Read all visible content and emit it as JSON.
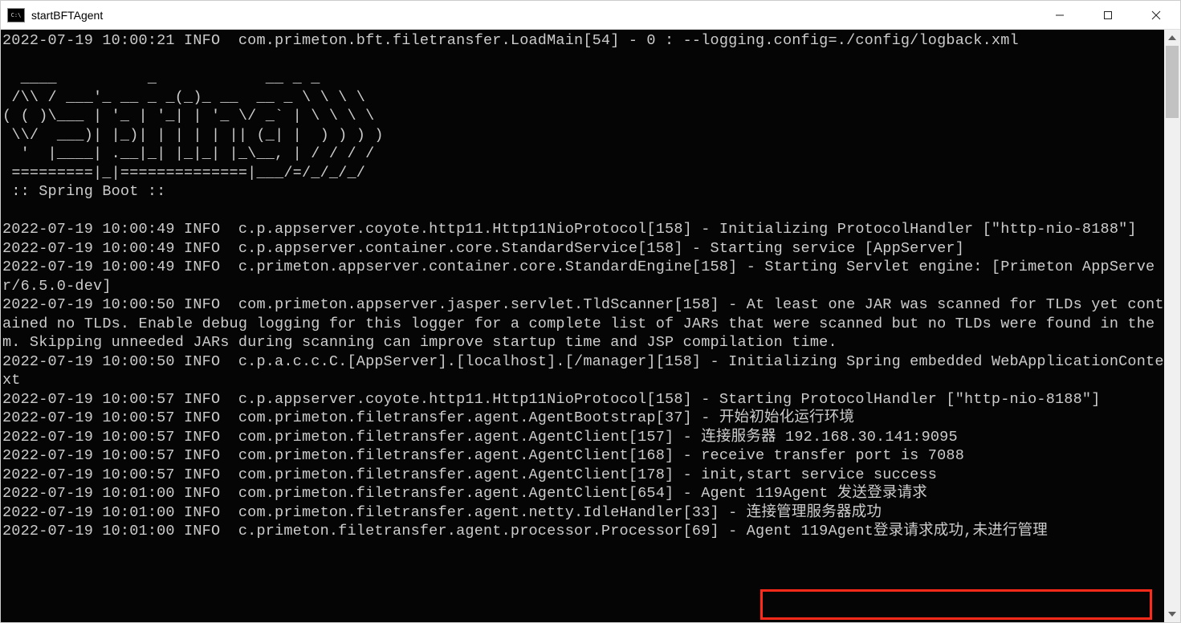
{
  "window": {
    "title": "startBFTAgent"
  },
  "logs": {
    "line01": "2022-07-19 10:00:21 INFO  com.primeton.bft.filetransfer.LoadMain[54] - 0 : --logging.config=./config/logback.xml",
    "blank1": "",
    "ascii1": "  ____          _            __ _ _",
    "ascii2": " /\\\\ / ___'_ __ _ _(_)_ __  __ _ \\ \\ \\ \\",
    "ascii3": "( ( )\\___ | '_ | '_| | '_ \\/ _` | \\ \\ \\ \\",
    "ascii4": " \\\\/  ___)| |_)| | | | | || (_| |  ) ) ) )",
    "ascii5": "  '  |____| .__|_| |_|_| |_\\__, | / / / /",
    "ascii6": " =========|_|==============|___/=/_/_/_/",
    "springboot": " :: Spring Boot ::",
    "blank2": "",
    "line02": "2022-07-19 10:00:49 INFO  c.p.appserver.coyote.http11.Http11NioProtocol[158] - Initializing ProtocolHandler [\"http-nio-8188\"]",
    "line03": "2022-07-19 10:00:49 INFO  c.p.appserver.container.core.StandardService[158] - Starting service [AppServer]",
    "line04": "2022-07-19 10:00:49 INFO  c.primeton.appserver.container.core.StandardEngine[158] - Starting Servlet engine: [Primeton AppServer/6.5.0-dev]",
    "line05": "2022-07-19 10:00:50 INFO  com.primeton.appserver.jasper.servlet.TldScanner[158] - At least one JAR was scanned for TLDs yet contained no TLDs. Enable debug logging for this logger for a complete list of JARs that were scanned but no TLDs were found in them. Skipping unneeded JARs during scanning can improve startup time and JSP compilation time.",
    "line06": "2022-07-19 10:00:50 INFO  c.p.a.c.c.C.[AppServer].[localhost].[/manager][158] - Initializing Spring embedded WebApplicationContext",
    "line07": "2022-07-19 10:00:57 INFO  c.p.appserver.coyote.http11.Http11NioProtocol[158] - Starting ProtocolHandler [\"http-nio-8188\"]",
    "line08": "2022-07-19 10:00:57 INFO  com.primeton.filetransfer.agent.AgentBootstrap[37] - 开始初始化运行环境",
    "line09": "2022-07-19 10:00:57 INFO  com.primeton.filetransfer.agent.AgentClient[157] - 连接服务器 192.168.30.141:9095",
    "line10": "2022-07-19 10:00:57 INFO  com.primeton.filetransfer.agent.AgentClient[168] - receive transfer port is 7088",
    "line11": "2022-07-19 10:00:57 INFO  com.primeton.filetransfer.agent.AgentClient[178] - init,start service success",
    "line12": "2022-07-19 10:01:00 INFO  com.primeton.filetransfer.agent.AgentClient[654] - Agent 119Agent 发送登录请求",
    "line13": "2022-07-19 10:01:00 INFO  com.primeton.filetransfer.agent.netty.IdleHandler[33] - 连接管理服务器成功",
    "line14": "2022-07-19 10:01:00 INFO  c.primeton.filetransfer.agent.processor.Processor[69] - Agent 119Agent登录请求成功,未进行管理"
  },
  "highlight_text": "Agent 119Agent登录请求成功,未进行管理"
}
